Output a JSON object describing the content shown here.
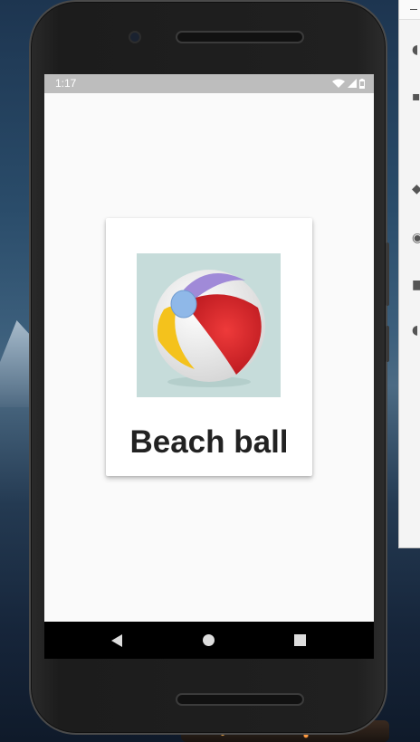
{
  "status_bar": {
    "time": "1:17",
    "icons": [
      "wifi-icon",
      "signal-icon",
      "battery-icon"
    ]
  },
  "card": {
    "title": "Beach ball",
    "image": "beach-ball-image"
  },
  "nav_bar": {
    "buttons": [
      "back-button",
      "home-button",
      "recents-button"
    ]
  },
  "colors": {
    "screen_background": "#fafafa",
    "status_bar": "#bdbdbd",
    "nav_bar": "#000000",
    "image_background": "#c6dcda",
    "ball_red": "#d61f26",
    "ball_purple": "#a08ad8",
    "ball_yellow": "#f4c21c",
    "ball_blue": "#8fb8e8"
  }
}
